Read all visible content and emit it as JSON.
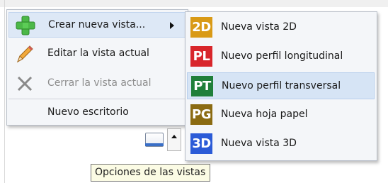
{
  "main_menu": {
    "items": [
      {
        "label": "Crear nueva vista...",
        "icon": "green-plus-icon",
        "state": "hover",
        "has_submenu": true
      },
      {
        "label": "Editar la vista actual",
        "icon": "pencil-icon",
        "state": "normal"
      },
      {
        "label": "Cerrar la vista actual",
        "icon": "close-x-icon",
        "state": "disabled"
      },
      {
        "label": "Nuevo escritorio",
        "icon": "",
        "state": "normal"
      }
    ]
  },
  "submenu": {
    "items": [
      {
        "badge": "2D",
        "badge_color": "#d99a16",
        "label": "Nueva vista 2D",
        "state": "normal"
      },
      {
        "badge": "PL",
        "badge_color": "#d8262b",
        "label": "Nuevo perfil longitudinal",
        "state": "normal"
      },
      {
        "badge": "PT",
        "badge_color": "#1f7f3a",
        "label": "Nuevo perfil transversal",
        "state": "hover"
      },
      {
        "badge": "PG",
        "badge_color": "#8b6b12",
        "label": "Nueva hoja papel",
        "state": "normal"
      },
      {
        "badge": "3D",
        "badge_color": "#2b5bd7",
        "label": "Nueva vista 3D",
        "state": "normal"
      }
    ]
  },
  "toolbar": {
    "view_button_icon": "view-options-icon",
    "dropdown_icon": "chevron-up-icon"
  },
  "tooltip": {
    "text": "Opciones de las vistas"
  },
  "colors": {
    "menu_bg": "#f4f6f9",
    "hover_bg": "#d6e4f5",
    "tooltip_bg": "#fbfbe4"
  }
}
